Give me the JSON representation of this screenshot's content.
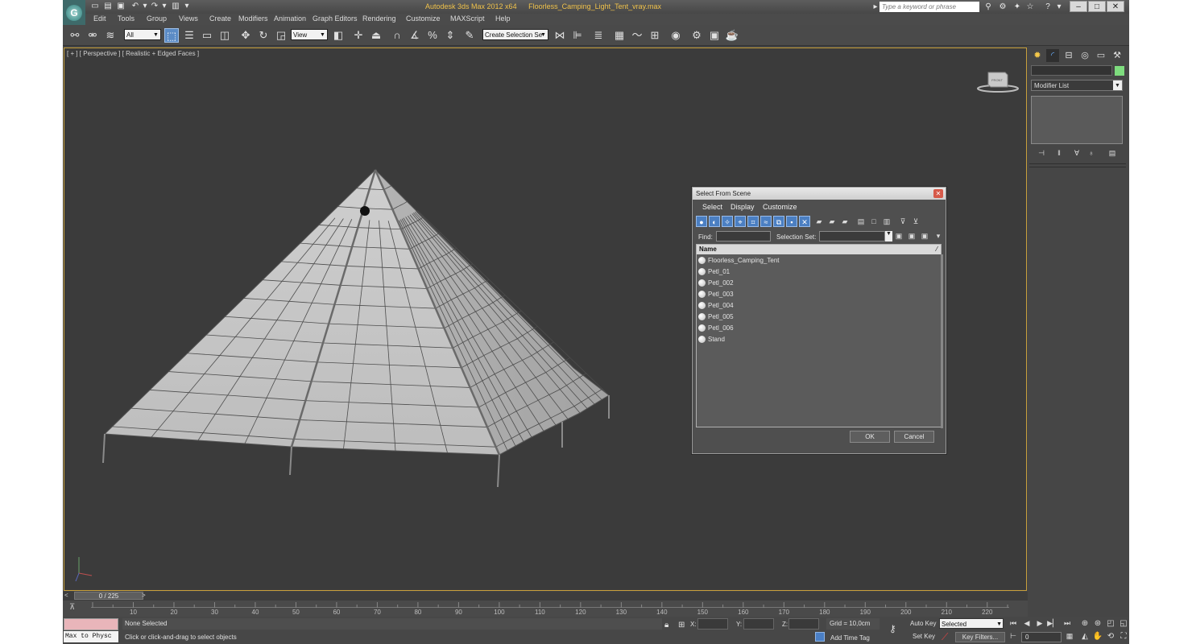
{
  "window": {
    "app_title": "Autodesk 3ds Max  2012 x64",
    "file_name": "Floorless_Camping_Light_Tent_vray.max",
    "search_placeholder": "Type a keyword or phrase"
  },
  "menubar": {
    "items": [
      "Edit",
      "Tools",
      "Group",
      "Views",
      "Create",
      "Modifiers",
      "Animation",
      "Graph Editors",
      "Rendering",
      "Customize",
      "MAXScript",
      "Help"
    ]
  },
  "toolbar": {
    "filter_value": "All",
    "refcoord_value": "View",
    "selection_set_placeholder": "Create Selection Se"
  },
  "viewport": {
    "label": "[ + ] [ Perspective ] [ Realistic + Edged Faces ]",
    "viewcube_label": "FRONT"
  },
  "command_panel": {
    "modifier_list_label": "Modifier List",
    "object_color": "#7edc7e"
  },
  "dialog": {
    "title": "Select From Scene",
    "menu": [
      "Select",
      "Display",
      "Customize"
    ],
    "find_label": "Find:",
    "selection_set_label": "Selection Set:",
    "column_header": "Name",
    "objects": [
      "Floorless_Camping_Tent",
      "Petl_01",
      "Petl_002",
      "Petl_003",
      "Petl_004",
      "Petl_005",
      "Petl_006",
      "Stand"
    ],
    "ok_label": "OK",
    "cancel_label": "Cancel"
  },
  "timeline": {
    "frame_display": "0 / 225",
    "prev_arrow": "<",
    "next_arrow": ">",
    "ticks": [
      "10",
      "20",
      "30",
      "40",
      "50",
      "60",
      "70",
      "80",
      "90",
      "100",
      "110",
      "120",
      "130",
      "140",
      "150",
      "160",
      "170",
      "180",
      "190",
      "200",
      "210",
      "220"
    ]
  },
  "statusbar": {
    "maxscript_label": "Max to Physc",
    "selection_status": "None Selected",
    "prompt": "Click or click-and-drag to select objects",
    "x_label": "X:",
    "y_label": "Y:",
    "z_label": "Z:",
    "grid": "Grid = 10,0cm",
    "add_time_tag": "Add Time Tag",
    "auto_key": "Auto Key",
    "set_key": "Set Key",
    "key_mode_value": "Selected",
    "key_filters": "Key Filters...",
    "current_frame": "0"
  }
}
